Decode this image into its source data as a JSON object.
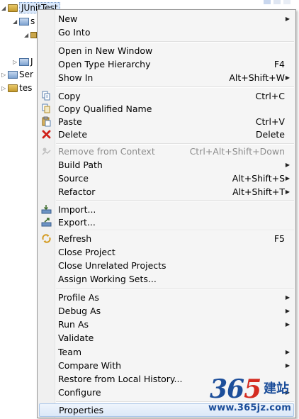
{
  "tree": {
    "project_label": "JUnitTest",
    "row2_label": "s",
    "row4_label": "J",
    "row5_label": "Ser",
    "row6_label": "tes"
  },
  "menu": {
    "items": [
      {
        "label": "New",
        "shortcut": "",
        "submenu": true,
        "icon": "",
        "disabled": false
      },
      {
        "label": "Go Into",
        "shortcut": "",
        "submenu": false,
        "icon": "",
        "disabled": false
      },
      {
        "label": "Open in New Window",
        "shortcut": "",
        "submenu": false,
        "icon": "",
        "disabled": false
      },
      {
        "label": "Open Type Hierarchy",
        "shortcut": "F4",
        "submenu": false,
        "icon": "",
        "disabled": false
      },
      {
        "label": "Show In",
        "shortcut": "Alt+Shift+W",
        "submenu": true,
        "icon": "",
        "disabled": false
      },
      {
        "label": "Copy",
        "shortcut": "Ctrl+C",
        "submenu": false,
        "icon": "copy-icon",
        "disabled": false
      },
      {
        "label": "Copy Qualified Name",
        "shortcut": "",
        "submenu": false,
        "icon": "copy-qualified-name-icon",
        "disabled": false
      },
      {
        "label": "Paste",
        "shortcut": "Ctrl+V",
        "submenu": false,
        "icon": "paste-icon",
        "disabled": false
      },
      {
        "label": "Delete",
        "shortcut": "Delete",
        "submenu": false,
        "icon": "delete-icon",
        "disabled": false
      },
      {
        "label": "Remove from Context",
        "shortcut": "Ctrl+Alt+Shift+Down",
        "submenu": false,
        "icon": "remove-from-context-icon",
        "disabled": true
      },
      {
        "label": "Build Path",
        "shortcut": "",
        "submenu": true,
        "icon": "",
        "disabled": false
      },
      {
        "label": "Source",
        "shortcut": "Alt+Shift+S",
        "submenu": true,
        "icon": "",
        "disabled": false
      },
      {
        "label": "Refactor",
        "shortcut": "Alt+Shift+T",
        "submenu": true,
        "icon": "",
        "disabled": false
      },
      {
        "label": "Import...",
        "shortcut": "",
        "submenu": false,
        "icon": "import-icon",
        "disabled": false
      },
      {
        "label": "Export...",
        "shortcut": "",
        "submenu": false,
        "icon": "export-icon",
        "disabled": false
      },
      {
        "label": "Refresh",
        "shortcut": "F5",
        "submenu": false,
        "icon": "refresh-icon",
        "disabled": false
      },
      {
        "label": "Close Project",
        "shortcut": "",
        "submenu": false,
        "icon": "",
        "disabled": false
      },
      {
        "label": "Close Unrelated Projects",
        "shortcut": "",
        "submenu": false,
        "icon": "",
        "disabled": false
      },
      {
        "label": "Assign Working Sets...",
        "shortcut": "",
        "submenu": false,
        "icon": "",
        "disabled": false
      },
      {
        "label": "Profile As",
        "shortcut": "",
        "submenu": true,
        "icon": "",
        "disabled": false
      },
      {
        "label": "Debug As",
        "shortcut": "",
        "submenu": true,
        "icon": "",
        "disabled": false
      },
      {
        "label": "Run As",
        "shortcut": "",
        "submenu": true,
        "icon": "",
        "disabled": false
      },
      {
        "label": "Validate",
        "shortcut": "",
        "submenu": false,
        "icon": "",
        "disabled": false
      },
      {
        "label": "Team",
        "shortcut": "",
        "submenu": true,
        "icon": "",
        "disabled": false
      },
      {
        "label": "Compare With",
        "shortcut": "",
        "submenu": true,
        "icon": "",
        "disabled": false
      },
      {
        "label": "Restore from Local History...",
        "shortcut": "",
        "submenu": false,
        "icon": "",
        "disabled": false
      },
      {
        "label": "Configure",
        "shortcut": "",
        "submenu": true,
        "icon": "",
        "disabled": false
      },
      {
        "label": "Properties",
        "shortcut": "",
        "submenu": false,
        "icon": "",
        "disabled": false,
        "highlighted": true
      }
    ]
  },
  "watermark": {
    "number_part1": "36",
    "number_part2": "5",
    "chinese": "建站",
    "url": "www.365jz.com"
  },
  "colors": {
    "watermark_blue": "#1c4e9a",
    "watermark_red": "#d42b20",
    "menu_bg": "#f5f5f5",
    "highlight": "#dbe8f8"
  }
}
